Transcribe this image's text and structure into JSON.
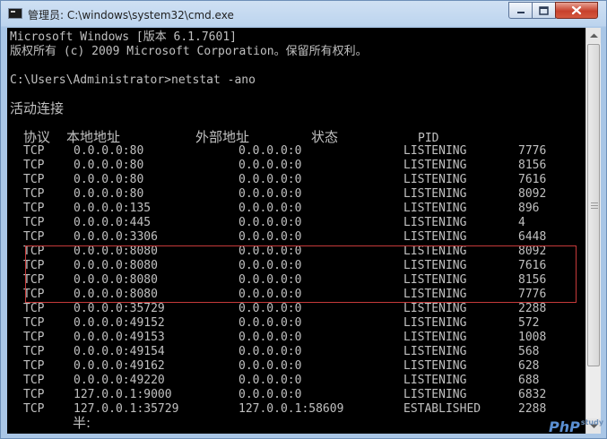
{
  "window": {
    "title": "管理员: C:\\windows\\system32\\cmd.exe",
    "controls": {
      "minimize": "minimize",
      "maximize": "maximize",
      "close": "close"
    }
  },
  "console": {
    "banner_1": "Microsoft Windows [版本 6.1.7601]",
    "banner_2": "版权所有 (c) 2009 Microsoft Corporation。保留所有权利。",
    "prompt": "C:\\Users\\Administrator>netstat -ano",
    "section_title": "活动连接",
    "headers": {
      "proto": "协议",
      "local": "本地地址",
      "foreign": "外部地址",
      "state": "状态",
      "pid": "PID"
    },
    "rows": [
      {
        "proto": "TCP",
        "local": "0.0.0.0:80",
        "foreign": "0.0.0.0:0",
        "state": "LISTENING",
        "pid": "7776"
      },
      {
        "proto": "TCP",
        "local": "0.0.0.0:80",
        "foreign": "0.0.0.0:0",
        "state": "LISTENING",
        "pid": "8156"
      },
      {
        "proto": "TCP",
        "local": "0.0.0.0:80",
        "foreign": "0.0.0.0:0",
        "state": "LISTENING",
        "pid": "7616"
      },
      {
        "proto": "TCP",
        "local": "0.0.0.0:80",
        "foreign": "0.0.0.0:0",
        "state": "LISTENING",
        "pid": "8092"
      },
      {
        "proto": "TCP",
        "local": "0.0.0.0:135",
        "foreign": "0.0.0.0:0",
        "state": "LISTENING",
        "pid": "896"
      },
      {
        "proto": "TCP",
        "local": "0.0.0.0:445",
        "foreign": "0.0.0.0:0",
        "state": "LISTENING",
        "pid": "4"
      },
      {
        "proto": "TCP",
        "local": "0.0.0.0:3306",
        "foreign": "0.0.0.0:0",
        "state": "LISTENING",
        "pid": "6448"
      },
      {
        "proto": "TCP",
        "local": "0.0.0.0:8080",
        "foreign": "0.0.0.0:0",
        "state": "LISTENING",
        "pid": "8092"
      },
      {
        "proto": "TCP",
        "local": "0.0.0.0:8080",
        "foreign": "0.0.0.0:0",
        "state": "LISTENING",
        "pid": "7616"
      },
      {
        "proto": "TCP",
        "local": "0.0.0.0:8080",
        "foreign": "0.0.0.0:0",
        "state": "LISTENING",
        "pid": "8156"
      },
      {
        "proto": "TCP",
        "local": "0.0.0.0:8080",
        "foreign": "0.0.0.0:0",
        "state": "LISTENING",
        "pid": "7776"
      },
      {
        "proto": "TCP",
        "local": "0.0.0.0:35729",
        "foreign": "0.0.0.0:0",
        "state": "LISTENING",
        "pid": "2288"
      },
      {
        "proto": "TCP",
        "local": "0.0.0.0:49152",
        "foreign": "0.0.0.0:0",
        "state": "LISTENING",
        "pid": "572"
      },
      {
        "proto": "TCP",
        "local": "0.0.0.0:49153",
        "foreign": "0.0.0.0:0",
        "state": "LISTENING",
        "pid": "1008"
      },
      {
        "proto": "TCP",
        "local": "0.0.0.0:49154",
        "foreign": "0.0.0.0:0",
        "state": "LISTENING",
        "pid": "568"
      },
      {
        "proto": "TCP",
        "local": "0.0.0.0:49162",
        "foreign": "0.0.0.0:0",
        "state": "LISTENING",
        "pid": "628"
      },
      {
        "proto": "TCP",
        "local": "0.0.0.0:49220",
        "foreign": "0.0.0.0:0",
        "state": "LISTENING",
        "pid": "688"
      },
      {
        "proto": "TCP",
        "local": "127.0.0.1:9000",
        "foreign": "0.0.0.0:0",
        "state": "LISTENING",
        "pid": "6832"
      },
      {
        "proto": "TCP",
        "local": "127.0.0.1:35729",
        "foreign": "127.0.0.1:58609",
        "state": "ESTABLISHED",
        "pid": "2288"
      }
    ],
    "trailing_text": "半:"
  },
  "watermark": {
    "text": "PhP",
    "sub": "study"
  },
  "colors": {
    "console_bg": "#000000",
    "console_fg": "#c0c0c0",
    "highlight": "#c63a3a"
  }
}
